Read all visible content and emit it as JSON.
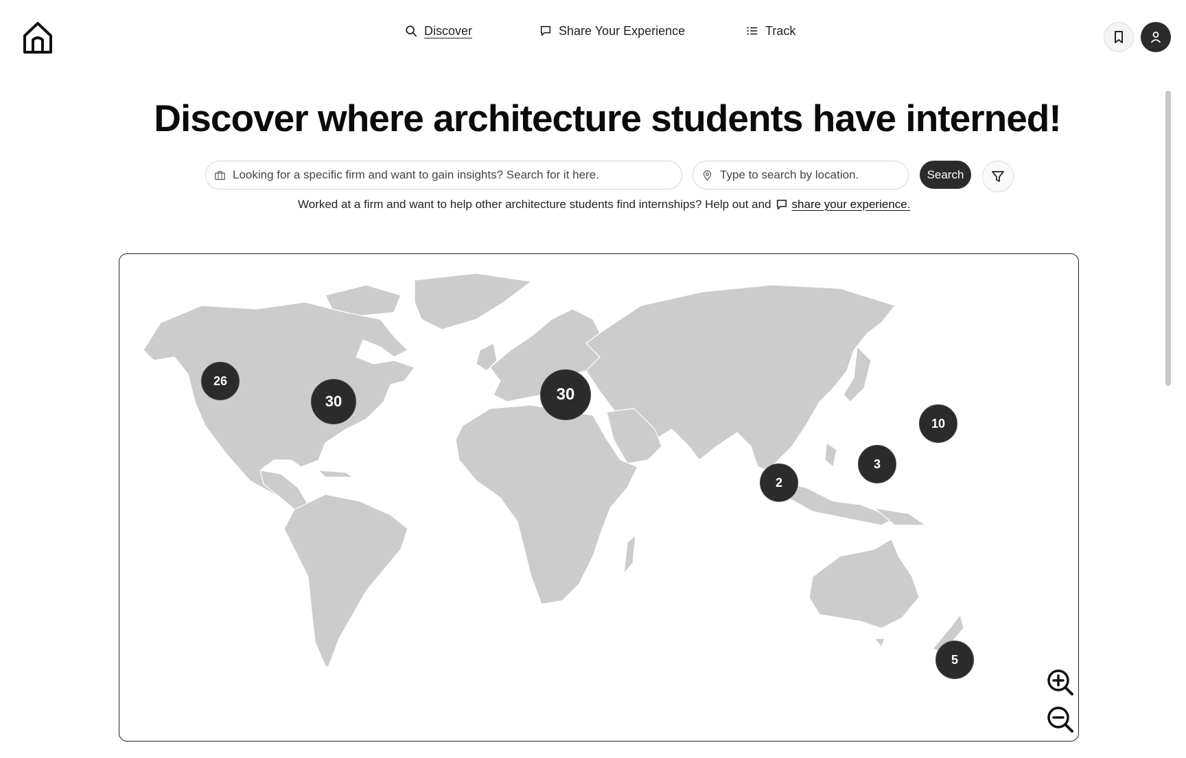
{
  "nav": {
    "discover_label": "Discover",
    "share_label": "Share Your Experience",
    "track_label": "Track",
    "icons": {
      "home": "home-icon",
      "discover": "search-icon",
      "share": "chat-icon",
      "track": "list-icon",
      "bookmark": "bookmark-icon",
      "profile": "user-icon"
    }
  },
  "hero": {
    "title": "Discover where architecture students have interned!"
  },
  "search": {
    "firm_placeholder": "Looking for a specific firm and want to gain insights? Search for it here.",
    "location_placeholder": "Type to search by location.",
    "button_label": "Search",
    "icons": {
      "firm": "briefcase-icon",
      "location": "map-pin-icon",
      "filter": "filter-icon"
    }
  },
  "helper": {
    "text": "Worked at a firm and want to help other architecture students find internships? Help out and",
    "link_label": "share your experience."
  },
  "map": {
    "clusters": [
      {
        "id": "us-west",
        "count": "26"
      },
      {
        "id": "us-east",
        "count": "30"
      },
      {
        "id": "europe",
        "count": "30"
      },
      {
        "id": "east-asia",
        "count": "10"
      },
      {
        "id": "southeast-asia",
        "count": "3"
      },
      {
        "id": "india",
        "count": "2"
      },
      {
        "id": "australia",
        "count": "5"
      }
    ],
    "zoom_in": "zoom-in-icon",
    "zoom_out": "zoom-out-icon",
    "land_color": "#cccccc",
    "cluster_color": "#2b2b2b"
  }
}
